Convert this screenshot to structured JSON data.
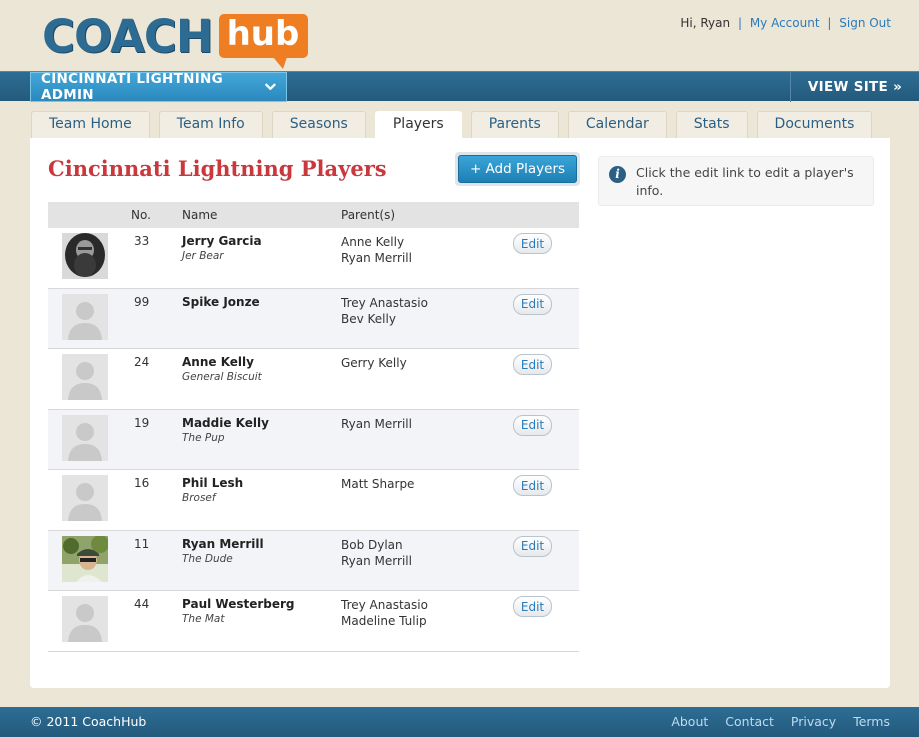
{
  "logo": {
    "part1": "COACH",
    "part2": "hub"
  },
  "user": {
    "greeting": "Hi, Ryan",
    "my_account": "My Account",
    "sign_out": "Sign Out",
    "separator": "|"
  },
  "nav": {
    "team_name": "CINCINNATI LIGHTNING ADMIN",
    "view_site": "VIEW SITE »"
  },
  "tabs": [
    {
      "label": "Team Home"
    },
    {
      "label": "Team Info"
    },
    {
      "label": "Seasons"
    },
    {
      "label": "Players",
      "active": true
    },
    {
      "label": "Parents"
    },
    {
      "label": "Calendar"
    },
    {
      "label": "Stats"
    },
    {
      "label": "Documents"
    }
  ],
  "main": {
    "title": "Cincinnati Lightning Players",
    "add_button": "+ Add Players",
    "info": "Click the edit link to edit a player's info.",
    "table": {
      "headers": {
        "no": "No.",
        "name": "Name",
        "parents": "Parent(s)"
      },
      "edit_label": "Edit",
      "rows": [
        {
          "no": "33",
          "name": "Jerry Garcia",
          "nick": "Jer Bear",
          "parents": [
            "Anne Kelly",
            "Ryan Merrill"
          ],
          "photo": "photo-jerry"
        },
        {
          "no": "99",
          "name": "Spike Jonze",
          "nick": "",
          "parents": [
            "Trey Anastasio",
            "Bev Kelly"
          ],
          "photo": "placeholder"
        },
        {
          "no": "24",
          "name": "Anne Kelly",
          "nick": "General Biscuit",
          "parents": [
            "Gerry Kelly"
          ],
          "photo": "placeholder"
        },
        {
          "no": "19",
          "name": "Maddie Kelly",
          "nick": "The Pup",
          "parents": [
            "Ryan Merrill"
          ],
          "photo": "placeholder"
        },
        {
          "no": "16",
          "name": "Phil Lesh",
          "nick": "Brosef",
          "parents": [
            "Matt Sharpe"
          ],
          "photo": "placeholder"
        },
        {
          "no": "11",
          "name": "Ryan Merrill",
          "nick": "The Dude",
          "parents": [
            "Bob Dylan",
            "Ryan Merrill"
          ],
          "photo": "photo-ryan"
        },
        {
          "no": "44",
          "name": "Paul Westerberg",
          "nick": "The Mat",
          "parents": [
            "Trey Anastasio",
            "Madeline Tulip"
          ],
          "photo": "placeholder"
        }
      ]
    }
  },
  "footer": {
    "copyright": "© 2011 CoachHub",
    "links": [
      "About",
      "Contact",
      "Privacy",
      "Terms"
    ]
  },
  "colors": {
    "brand_blue": "#2d6b92",
    "brand_orange": "#ef7d22",
    "title_red": "#c8383c",
    "link_blue": "#2b7bb9"
  },
  "icons": {
    "dropdown": "chevron-down-icon",
    "info": "info-icon"
  }
}
